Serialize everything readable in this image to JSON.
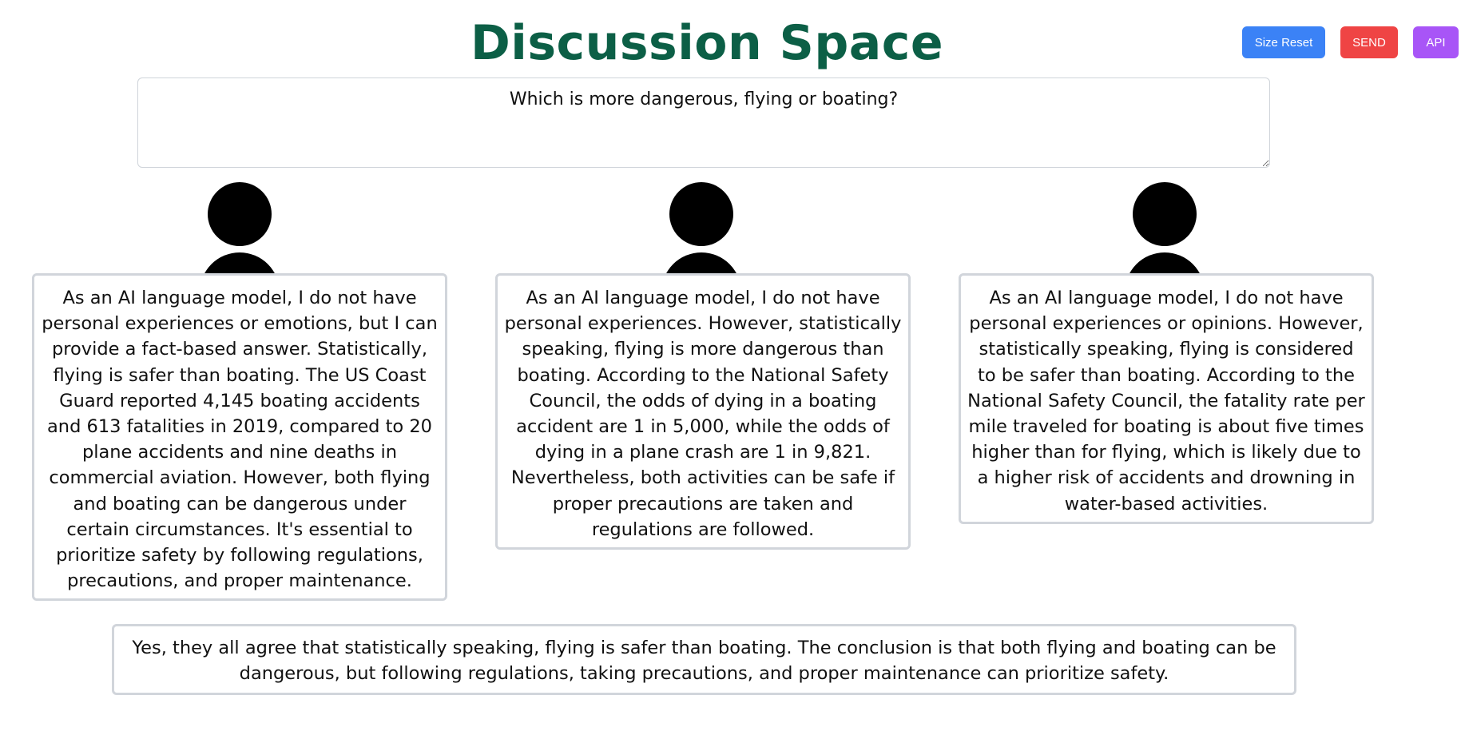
{
  "header": {
    "title": "Discussion Space",
    "buttons": {
      "size_reset": "Size Reset",
      "send": "SEND",
      "api": "API"
    }
  },
  "question": {
    "value": "Which is more dangerous, flying or boating?"
  },
  "agents": [
    {
      "avatar_icon": "user-icon",
      "response": "As an AI language model, I do not have personal experiences or emotions, but I can provide a fact-based answer. Statistically, flying is safer than boating. The US Coast Guard reported 4,145 boating accidents and 613 fatalities in 2019, compared to 20 plane accidents and nine deaths in commercial aviation. However, both flying and boating can be dangerous under certain circumstances. It's essential to prioritize safety by following regulations, precautions, and proper maintenance."
    },
    {
      "avatar_icon": "user-icon",
      "response": "As an AI language model, I do not have personal experiences. However, statistically speaking, flying is more dangerous than boating. According to the National Safety Council, the odds of dying in a boating accident are 1 in 5,000, while the odds of dying in a plane crash are 1 in 9,821. Nevertheless, both activities can be safe if proper precautions are taken and regulations are followed."
    },
    {
      "avatar_icon": "user-icon",
      "response": "As an AI language model, I do not have personal experiences or opinions. However, statistically speaking, flying is considered to be safer than boating. According to the National Safety Council, the fatality rate per mile traveled for boating is about five times higher than for flying, which is likely due to a higher risk of accidents and drowning in water-based activities."
    }
  ],
  "summary": {
    "text": "Yes, they all agree that statistically speaking, flying is safer than boating. The conclusion is that both flying and boating can be dangerous, but following regulations, taking precautions, and proper maintenance can prioritize safety."
  },
  "colors": {
    "title": "#0c5f46",
    "size_reset_button": "#3b82f6",
    "send_button": "#ef4444",
    "api_button": "#a855f7",
    "card_border": "#d1d5db"
  }
}
